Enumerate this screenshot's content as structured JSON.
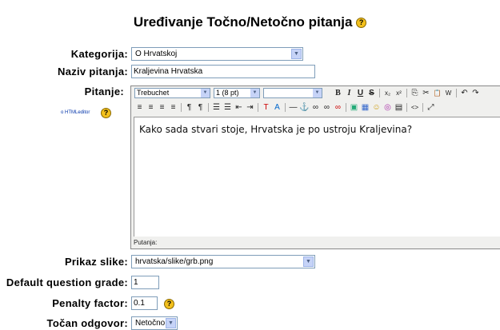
{
  "heading": {
    "title": "Uređivanje Točno/Netočno pitanja",
    "help_icon": "help-icon"
  },
  "form": {
    "category": {
      "label": "Kategorija:",
      "value": "O Hrvatskoj"
    },
    "question_name": {
      "label": "Naziv pitanja:",
      "value": "Kraljevina Hrvatska"
    },
    "question_text": {
      "label": "Pitanje:",
      "html_editor_link": "o HTMLeditor",
      "font_family": "Trebuchet",
      "font_size": "1 (8 pt)",
      "heading_select": "",
      "body": "Kako sada stvari stoje, Hrvatska je po ustroju Kraljevina?",
      "path_label": "Putanja:"
    },
    "image": {
      "label": "Prikaz slike:",
      "value": "hrvatska/slike/grb.png"
    },
    "default_grade": {
      "label": "Default question grade:",
      "value": "1"
    },
    "penalty": {
      "label": "Penalty factor:",
      "value": "0.1"
    },
    "correct_answer": {
      "label": "Točan odgovor:",
      "value": "Netočno"
    }
  },
  "toolbar": {
    "row1": [
      "B",
      "I",
      "U",
      "S",
      "x₂",
      "x²",
      "⎘",
      "✂",
      "📋",
      "W",
      "↶",
      "↷"
    ],
    "row2": [
      "≡",
      "≡",
      "≡",
      "≡",
      "¶",
      "¶",
      "☰",
      "☰",
      "⇤",
      "⇥",
      "T",
      "A",
      "—",
      "⚓",
      "∞",
      "∞",
      "∞",
      "▣",
      "▦",
      "☺",
      "◎",
      "▤",
      "<>",
      "⤢"
    ]
  },
  "colors": {
    "accent": "#f3c01c",
    "border": "#7f9db9",
    "arrow_bg": "#c6d3f7"
  }
}
